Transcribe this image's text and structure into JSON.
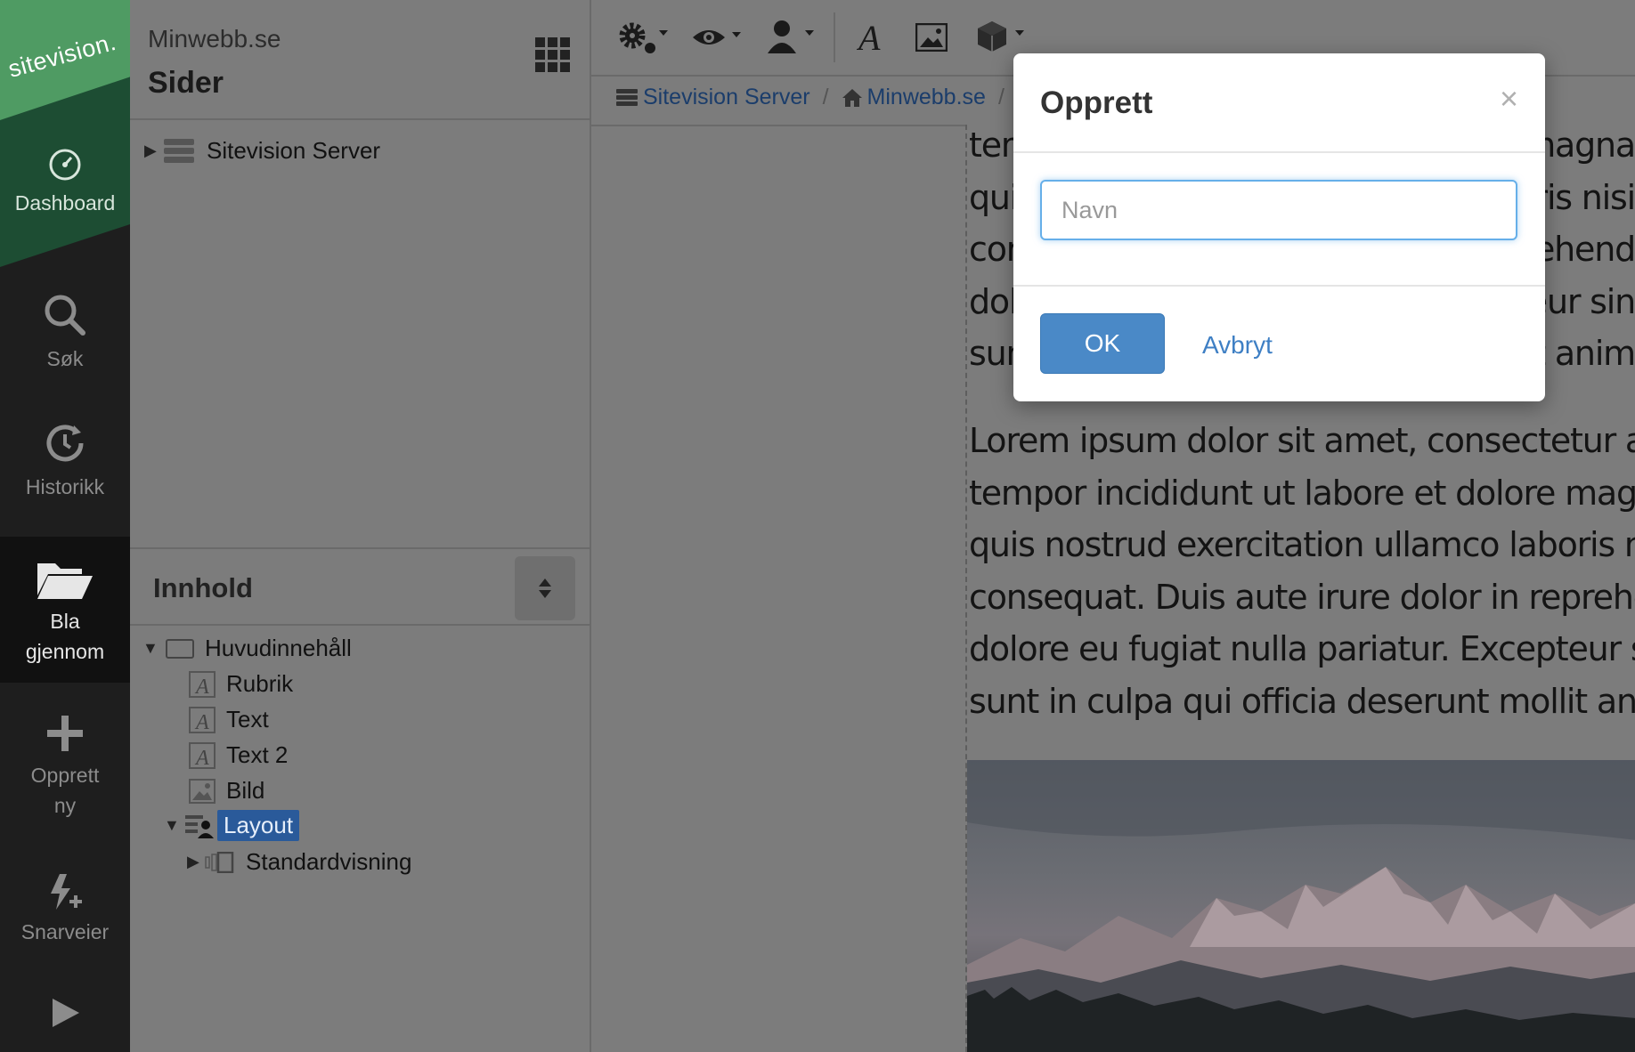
{
  "rail": {
    "brand": "sitevision.",
    "items": [
      {
        "label": "Dashboard",
        "icon": "dashboard-icon"
      },
      {
        "label": "Søk",
        "icon": "search-icon"
      },
      {
        "label": "Historikk",
        "icon": "history-icon"
      },
      {
        "label_line1": "Bla",
        "label_line2": "gjennom",
        "icon": "folder-open-icon"
      },
      {
        "label_line1": "Opprett",
        "label_line2": "ny",
        "icon": "plus-icon"
      },
      {
        "label": "Snarveier",
        "icon": "shortcut-icon"
      }
    ]
  },
  "panel": {
    "site_name": "Minwebb.se",
    "title": "Sider",
    "tree_root": "Sitevision Server",
    "content_title": "Innhold",
    "content_tree": [
      {
        "label": "Huvudinnehåll",
        "icon": "container-icon"
      },
      {
        "label": "Rubrik",
        "icon": "text-module-icon"
      },
      {
        "label": "Text",
        "icon": "text-module-icon"
      },
      {
        "label": "Text 2",
        "icon": "text-module-icon"
      },
      {
        "label": "Bild",
        "icon": "image-module-icon"
      },
      {
        "label": "Layout",
        "icon": "layout-icon",
        "selected": true
      },
      {
        "label": "Standardvisning",
        "icon": "view-icon"
      }
    ]
  },
  "breadcrumb": {
    "items": [
      "Sitevision Server",
      "Minwebb.se"
    ],
    "separator": "/"
  },
  "content": {
    "top_lines": [
      "tem",
      "qui",
      "cor",
      "dol",
      "sun"
    ],
    "top_right_lines": [
      "magna",
      "ris nisi",
      "rehend",
      "eur sin",
      "t anim"
    ],
    "paragraph_lines": [
      "Lorem ipsum dolor sit amet, consectetur adip",
      "tempor incididunt ut labore et dolore magna",
      "quis nostrud exercitation ullamco laboris nisi",
      "consequat. Duis aute irure dolor in reprehend",
      "dolore eu fugiat nulla pariatur. Excepteur sin",
      "sunt in culpa qui officia deserunt mollit anim"
    ]
  },
  "modal": {
    "title": "Opprett",
    "close_label": "×",
    "input_value": "",
    "input_placeholder": "Navn",
    "ok_label": "OK",
    "cancel_label": "Avbryt"
  },
  "colors": {
    "accent": "#4a89c7",
    "link": "#3e7fc4",
    "brand_green": "#4f9b63",
    "rail_bg": "#1e1e1e",
    "overlay_grey": "#7c7c7c",
    "selected_bg": "#2a5a9a"
  }
}
